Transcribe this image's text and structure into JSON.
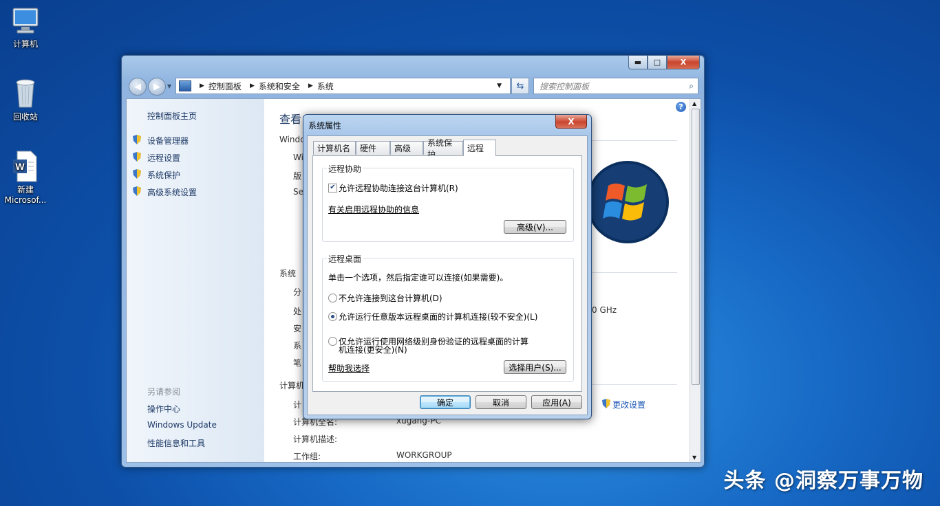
{
  "desktop": {
    "icons": [
      {
        "name": "computer",
        "label": "计算机"
      },
      {
        "name": "recycle-bin",
        "label": "回收站"
      },
      {
        "name": "word-doc",
        "label_line1": "新建",
        "label_line2": "Microsof..."
      }
    ],
    "watermark": "头条 @洞察万事万物"
  },
  "window": {
    "caption_buttons": {
      "minimize": "▬",
      "maximize": "□",
      "close": "X"
    },
    "breadcrumb": [
      "控制面板",
      "系统和安全",
      "系统"
    ],
    "search_placeholder": "搜索控制面板",
    "sidebar": {
      "home": "控制面板主页",
      "tasks": [
        "设备管理器",
        "远程设置",
        "系统保护",
        "高级系统设置"
      ],
      "see_also_title": "另请参阅",
      "see_also": [
        "操作中心",
        "Windows Update",
        "性能信息和工具"
      ]
    },
    "content": {
      "heading": "查看",
      "section_windows": "Windo",
      "win_lines": [
        "Wi",
        "版",
        "Se"
      ],
      "section_system": "系统",
      "sys_lines": [
        "分",
        "处",
        "安",
        "系",
        "笔"
      ],
      "cpu_fragment": "0 GHz",
      "section_computer": "计算机",
      "rows": [
        {
          "label": "计",
          "value": ""
        },
        {
          "label": "计算机全名:",
          "value": "xugang-PC"
        },
        {
          "label": "计算机描述:",
          "value": ""
        },
        {
          "label": "工作组:",
          "value": "WORKGROUP"
        }
      ],
      "change_settings": "更改设置"
    }
  },
  "dialog": {
    "title": "系统属性",
    "close": "X",
    "tabs": [
      "计算机名",
      "硬件",
      "高级",
      "系统保护",
      "远程"
    ],
    "active_tab": "远程",
    "remote_assistance": {
      "title": "远程协助",
      "checkbox_label": "允许远程协助连接这台计算机(R)",
      "checked": true,
      "info_link": "有关启用远程协助的信息",
      "advanced_button": "高级(V)..."
    },
    "remote_desktop": {
      "title": "远程桌面",
      "instruction": "单击一个选项，然后指定谁可以连接(如果需要)。",
      "options": [
        {
          "label": "不允许连接到这台计算机(D)",
          "selected": false
        },
        {
          "label": "允许运行任意版本远程桌面的计算机连接(较不安全)(L)",
          "selected": true
        },
        {
          "label_line1": "仅允许运行使用网络级别身份验证的远程桌面的计算",
          "label_line2": "机连接(更安全)(N)",
          "selected": false
        }
      ],
      "help_link": "帮助我选择",
      "select_users_button": "选择用户(S)..."
    },
    "buttons": {
      "ok": "确定",
      "cancel": "取消",
      "apply": "应用(A)"
    }
  }
}
